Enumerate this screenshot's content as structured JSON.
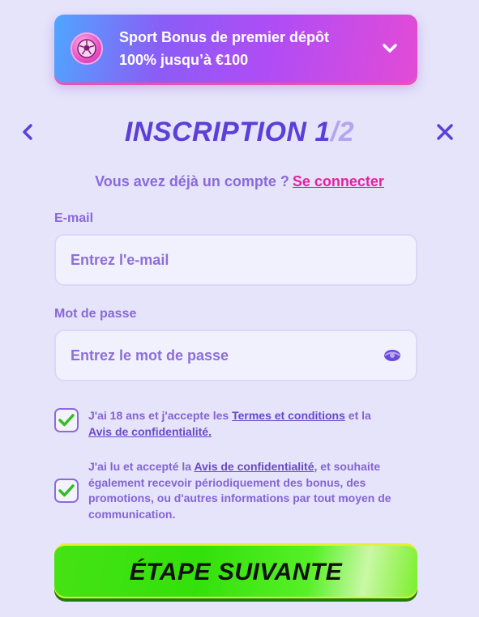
{
  "bonus": {
    "line1": "Sport Bonus de premier dépôt",
    "line2": "100% jusqu’à €100",
    "icon": "soccer-ball-icon",
    "chevron_icon": "chevron-down-icon"
  },
  "header": {
    "title": "INSCRIPTION 1",
    "step_total": "/2",
    "back_icon": "chevron-left-icon",
    "close_icon": "close-icon"
  },
  "login": {
    "prompt": "Vous avez déjà un compte ?",
    "link": "Se connecter"
  },
  "email": {
    "label": "E-mail",
    "placeholder": "Entrez l'e-mail",
    "value": ""
  },
  "password": {
    "label": "Mot de passe",
    "placeholder": "Entrez le mot de passe",
    "value": "",
    "toggle_icon": "eye-icon"
  },
  "terms": {
    "checked": true,
    "text_a": "J'ai 18 ans et j'accepte les ",
    "link_terms": "Termes et conditions",
    "text_b": " et la ",
    "link_privacy": "Avis de confidentialité."
  },
  "marketing": {
    "checked": true,
    "text_a": "J'ai lu et accepté la ",
    "link_privacy": "Avis de confidentialité",
    "text_b": ", et souhaite également recevoir périodiquement des bonus, des promotions, ou d'autres informations par tout moyen de communication."
  },
  "next_button": {
    "label": "ÉTAPE SUIVANTE"
  },
  "colors": {
    "background": "#e5e4fa",
    "accent": "#5b3fd8",
    "link_pink": "#e6219f",
    "button_green": "#33e10a"
  }
}
